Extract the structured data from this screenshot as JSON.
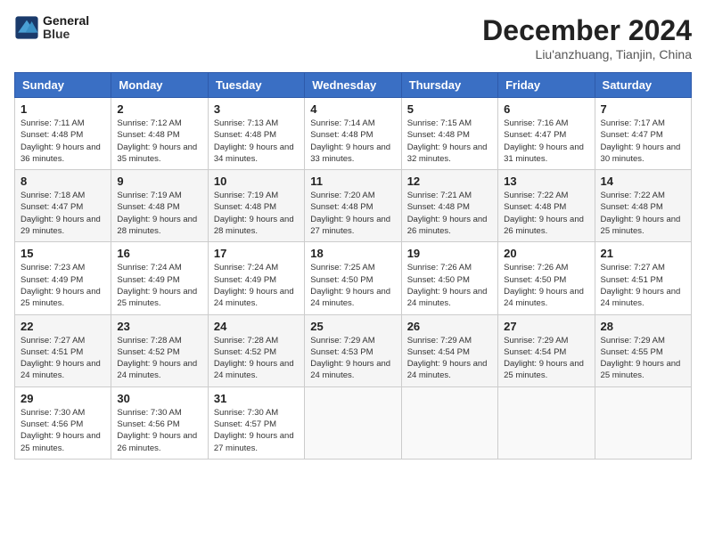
{
  "header": {
    "logo_line1": "General",
    "logo_line2": "Blue",
    "month": "December 2024",
    "location": "Liu'anzhuang, Tianjin, China"
  },
  "weekdays": [
    "Sunday",
    "Monday",
    "Tuesday",
    "Wednesday",
    "Thursday",
    "Friday",
    "Saturday"
  ],
  "weeks": [
    [
      {
        "day": "1",
        "rise": "7:11 AM",
        "set": "4:48 PM",
        "daylight": "9 hours and 36 minutes."
      },
      {
        "day": "2",
        "rise": "7:12 AM",
        "set": "4:48 PM",
        "daylight": "9 hours and 35 minutes."
      },
      {
        "day": "3",
        "rise": "7:13 AM",
        "set": "4:48 PM",
        "daylight": "9 hours and 34 minutes."
      },
      {
        "day": "4",
        "rise": "7:14 AM",
        "set": "4:48 PM",
        "daylight": "9 hours and 33 minutes."
      },
      {
        "day": "5",
        "rise": "7:15 AM",
        "set": "4:48 PM",
        "daylight": "9 hours and 32 minutes."
      },
      {
        "day": "6",
        "rise": "7:16 AM",
        "set": "4:47 PM",
        "daylight": "9 hours and 31 minutes."
      },
      {
        "day": "7",
        "rise": "7:17 AM",
        "set": "4:47 PM",
        "daylight": "9 hours and 30 minutes."
      }
    ],
    [
      {
        "day": "8",
        "rise": "7:18 AM",
        "set": "4:47 PM",
        "daylight": "9 hours and 29 minutes."
      },
      {
        "day": "9",
        "rise": "7:19 AM",
        "set": "4:48 PM",
        "daylight": "9 hours and 28 minutes."
      },
      {
        "day": "10",
        "rise": "7:19 AM",
        "set": "4:48 PM",
        "daylight": "9 hours and 28 minutes."
      },
      {
        "day": "11",
        "rise": "7:20 AM",
        "set": "4:48 PM",
        "daylight": "9 hours and 27 minutes."
      },
      {
        "day": "12",
        "rise": "7:21 AM",
        "set": "4:48 PM",
        "daylight": "9 hours and 26 minutes."
      },
      {
        "day": "13",
        "rise": "7:22 AM",
        "set": "4:48 PM",
        "daylight": "9 hours and 26 minutes."
      },
      {
        "day": "14",
        "rise": "7:22 AM",
        "set": "4:48 PM",
        "daylight": "9 hours and 25 minutes."
      }
    ],
    [
      {
        "day": "15",
        "rise": "7:23 AM",
        "set": "4:49 PM",
        "daylight": "9 hours and 25 minutes."
      },
      {
        "day": "16",
        "rise": "7:24 AM",
        "set": "4:49 PM",
        "daylight": "9 hours and 25 minutes."
      },
      {
        "day": "17",
        "rise": "7:24 AM",
        "set": "4:49 PM",
        "daylight": "9 hours and 24 minutes."
      },
      {
        "day": "18",
        "rise": "7:25 AM",
        "set": "4:50 PM",
        "daylight": "9 hours and 24 minutes."
      },
      {
        "day": "19",
        "rise": "7:26 AM",
        "set": "4:50 PM",
        "daylight": "9 hours and 24 minutes."
      },
      {
        "day": "20",
        "rise": "7:26 AM",
        "set": "4:50 PM",
        "daylight": "9 hours and 24 minutes."
      },
      {
        "day": "21",
        "rise": "7:27 AM",
        "set": "4:51 PM",
        "daylight": "9 hours and 24 minutes."
      }
    ],
    [
      {
        "day": "22",
        "rise": "7:27 AM",
        "set": "4:51 PM",
        "daylight": "9 hours and 24 minutes."
      },
      {
        "day": "23",
        "rise": "7:28 AM",
        "set": "4:52 PM",
        "daylight": "9 hours and 24 minutes."
      },
      {
        "day": "24",
        "rise": "7:28 AM",
        "set": "4:52 PM",
        "daylight": "9 hours and 24 minutes."
      },
      {
        "day": "25",
        "rise": "7:29 AM",
        "set": "4:53 PM",
        "daylight": "9 hours and 24 minutes."
      },
      {
        "day": "26",
        "rise": "7:29 AM",
        "set": "4:54 PM",
        "daylight": "9 hours and 24 minutes."
      },
      {
        "day": "27",
        "rise": "7:29 AM",
        "set": "4:54 PM",
        "daylight": "9 hours and 25 minutes."
      },
      {
        "day": "28",
        "rise": "7:29 AM",
        "set": "4:55 PM",
        "daylight": "9 hours and 25 minutes."
      }
    ],
    [
      {
        "day": "29",
        "rise": "7:30 AM",
        "set": "4:56 PM",
        "daylight": "9 hours and 25 minutes."
      },
      {
        "day": "30",
        "rise": "7:30 AM",
        "set": "4:56 PM",
        "daylight": "9 hours and 26 minutes."
      },
      {
        "day": "31",
        "rise": "7:30 AM",
        "set": "4:57 PM",
        "daylight": "9 hours and 27 minutes."
      },
      null,
      null,
      null,
      null
    ]
  ]
}
